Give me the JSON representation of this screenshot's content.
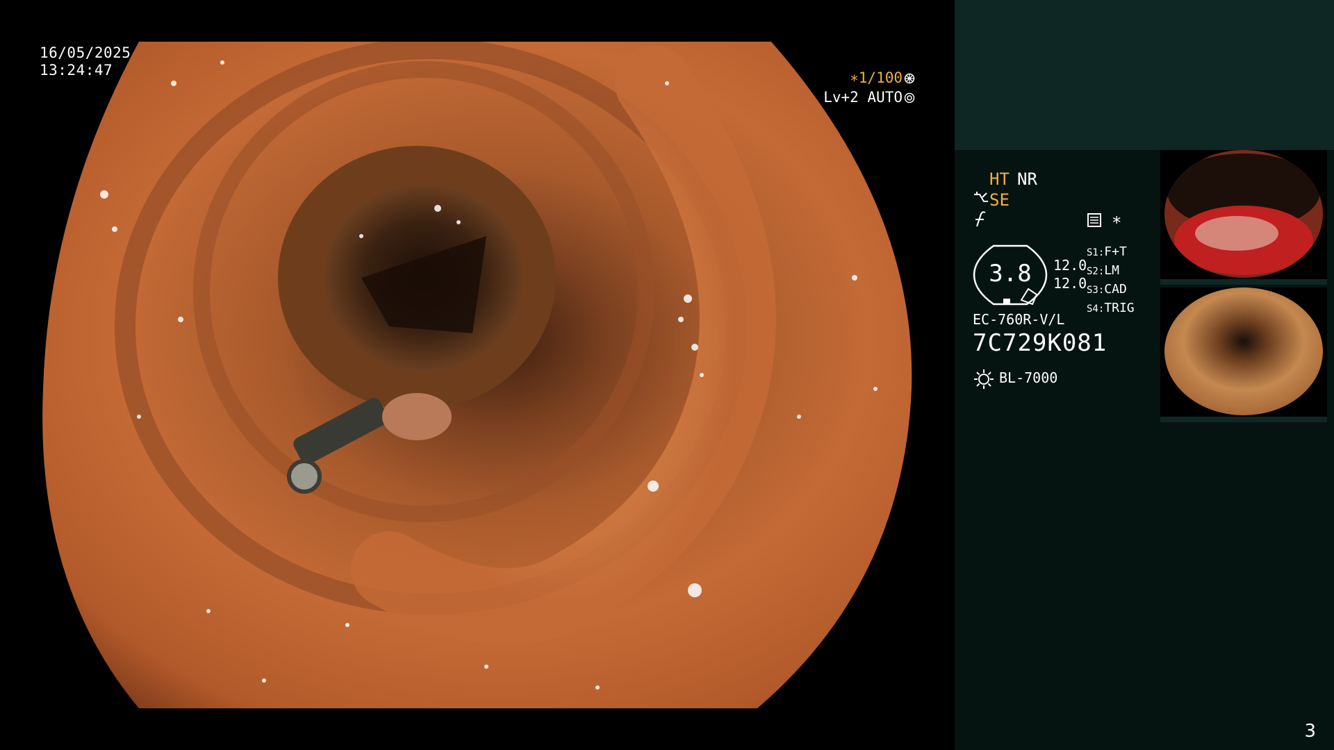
{
  "overlay": {
    "date": "16/05/2025",
    "time": "13:24:47",
    "zoom": "∗1/100",
    "level": "Lv+2 AUTO"
  },
  "panel": {
    "ht": "HT",
    "nr": "NR",
    "se": "SE",
    "star": "∗",
    "gauge_value": "3.8",
    "gauge_right_1": "12.0",
    "gauge_right_2": "12.0",
    "s_settings": [
      {
        "key": "S1:",
        "value": "F+T"
      },
      {
        "key": "S2:",
        "value": "LM"
      },
      {
        "key": "S3:",
        "value": "CAD"
      },
      {
        "key": "S4:",
        "value": "TRIG"
      }
    ],
    "scope_model": "EC-760R-V/L",
    "serial": "7C729K081",
    "light_source": "BL-7000"
  },
  "page_number": "3",
  "colors": {
    "panel_bg": "#061411",
    "panel_top": "#0f2724",
    "accent": "#f3b23a",
    "mucosa": "#c4703c"
  },
  "icons": [
    "zoom-icon",
    "auto-icon",
    "structure-enhance-icon",
    "f-icon",
    "mode-icon",
    "gauge-icon",
    "light-source-icon"
  ]
}
